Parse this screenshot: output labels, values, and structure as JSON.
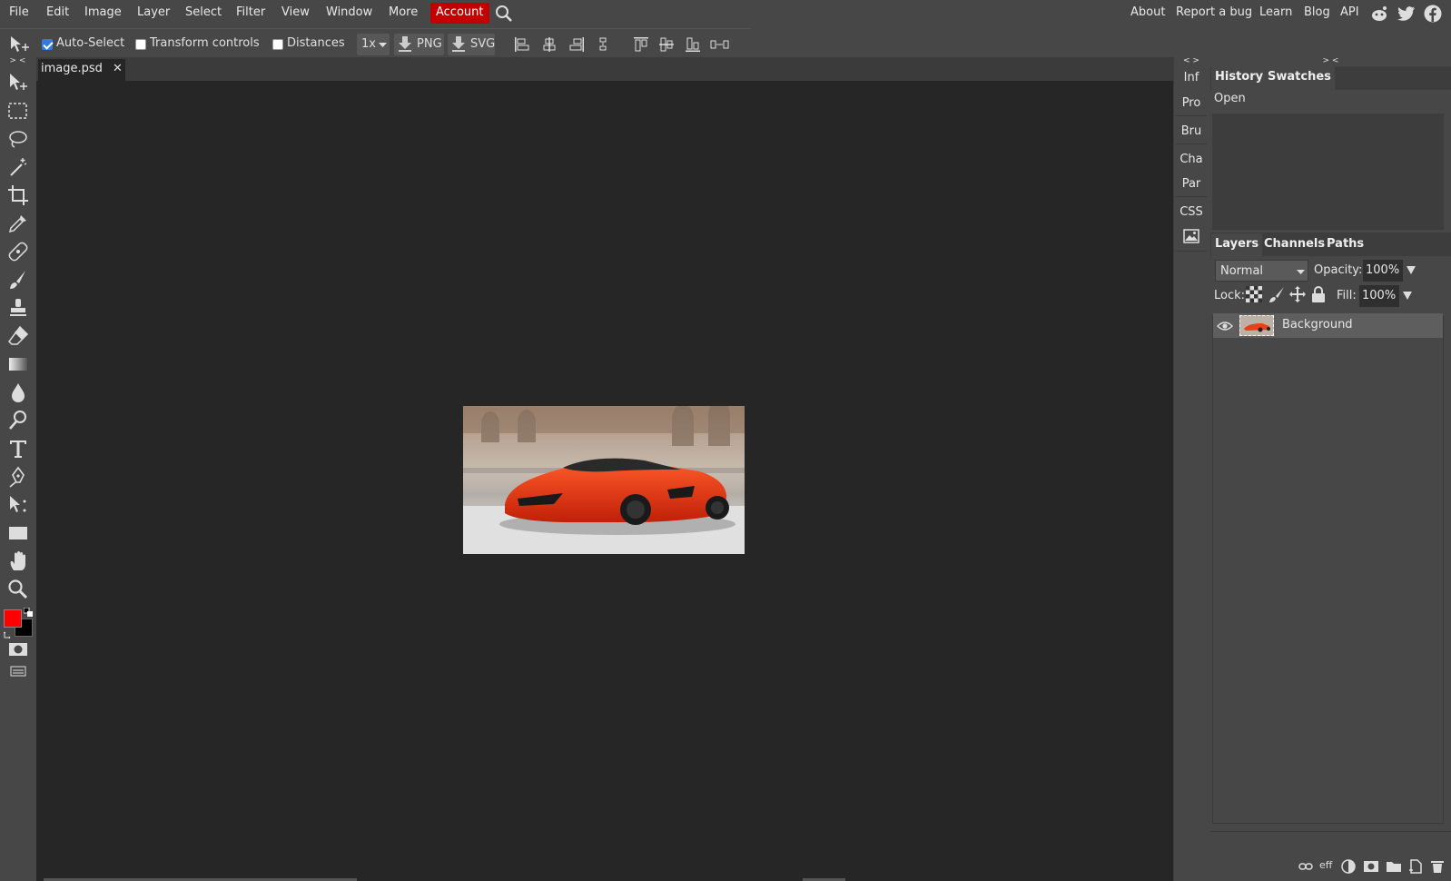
{
  "menu": {
    "items": [
      "File",
      "Edit",
      "Image",
      "Layer",
      "Select",
      "Filter",
      "View",
      "Window",
      "More"
    ],
    "account": "Account",
    "right_links": [
      "About",
      "Report a bug",
      "Learn",
      "Blog",
      "API"
    ]
  },
  "options": {
    "auto_select": "Auto-Select",
    "auto_select_checked": true,
    "transform_controls": "Transform controls",
    "distances": "Distances",
    "scale": "1x",
    "png": "PNG",
    "svg": "SVG"
  },
  "document": {
    "tab_title": "image.psd",
    "close_glyph": "✕"
  },
  "mini_panel": {
    "items": [
      "Inf",
      "Pro",
      "Bru",
      "Cha",
      "Par",
      "CSS"
    ]
  },
  "history_panel": {
    "tabs": [
      "History",
      "Swatches"
    ],
    "entries": [
      "Open"
    ]
  },
  "layers_panel": {
    "tabs": [
      "Layers",
      "Channels",
      "Paths"
    ],
    "blend_mode": "Normal",
    "opacity_label": "Opacity:",
    "opacity": "100%",
    "lock_label": "Lock:",
    "fill_label": "Fill:",
    "fill": "100%",
    "layers": [
      {
        "name": "Background",
        "visible": true
      }
    ],
    "footer_eff": "eff"
  },
  "colors": {
    "foreground": "#ff0000",
    "background": "#000000",
    "accent": "#c20000",
    "canvas_bg": "#262626",
    "ui_bg": "#474747"
  },
  "collapse_glyphs": {
    "left": "> <",
    "mini": "< >",
    "right": "> <"
  }
}
